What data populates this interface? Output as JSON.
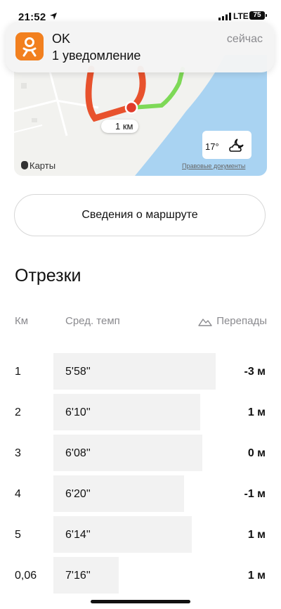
{
  "status_bar": {
    "time": "21:52",
    "network": "LTE",
    "battery": "75"
  },
  "notification": {
    "app_name": "OK",
    "message": "1 уведомление",
    "time": "сейчас",
    "brand_color": "#f2801f"
  },
  "map": {
    "distance_marker": "1 км",
    "temperature": "17°",
    "weather_icon": "moon-cloud-icon",
    "maps_label": "Карты",
    "legal_link": "Правовые документы",
    "route_color": "#e8522d",
    "route_end_color": "#7ed957",
    "water_color": "#a9d3f2"
  },
  "route_button": {
    "label": "Сведения о маршруте"
  },
  "segments": {
    "title": "Отрезки",
    "headers": {
      "km": "Км",
      "pace": "Сред. темп",
      "elevation": "Перепады"
    },
    "rows": [
      {
        "km": "1",
        "pace": "5'58''",
        "elevation": "-3 м",
        "pace_fraction": 0.82
      },
      {
        "km": "2",
        "pace": "6'10''",
        "elevation": "1 м",
        "pace_fraction": 0.74
      },
      {
        "km": "3",
        "pace": "6'08''",
        "elevation": "0 м",
        "pace_fraction": 0.75
      },
      {
        "km": "4",
        "pace": "6'20''",
        "elevation": "-1 м",
        "pace_fraction": 0.66
      },
      {
        "km": "5",
        "pace": "6'14''",
        "elevation": "1 м",
        "pace_fraction": 0.7
      },
      {
        "km": "0,06",
        "pace": "7'16''",
        "elevation": "1 м",
        "pace_fraction": 0.33
      }
    ]
  }
}
